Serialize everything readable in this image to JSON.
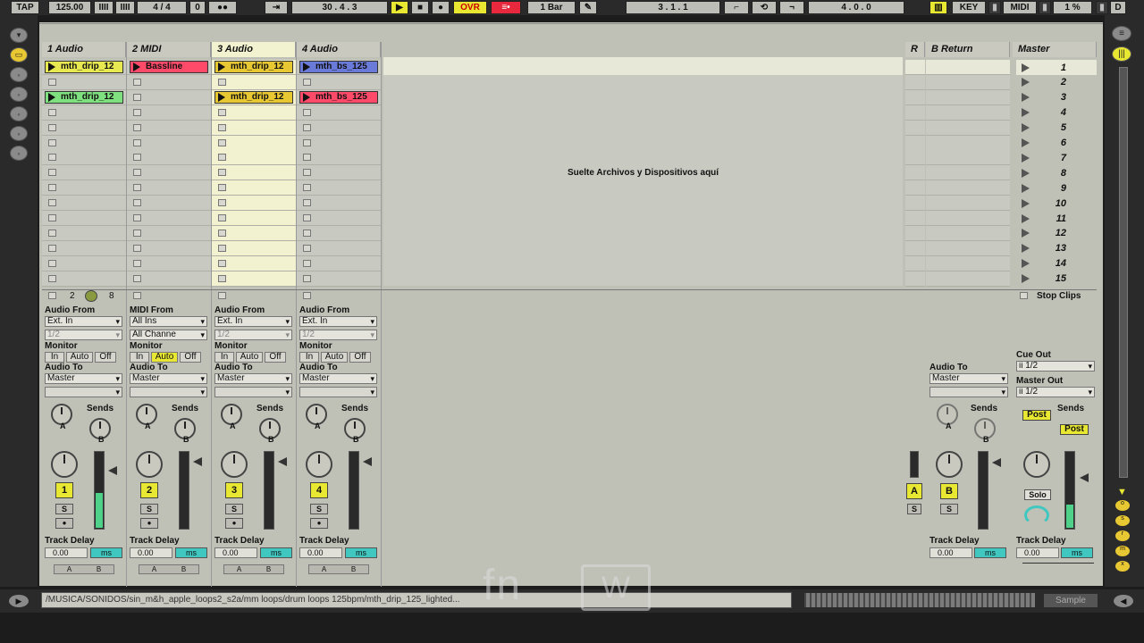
{
  "transport": {
    "tap": "TAP",
    "tempo": "125.00",
    "metronome_icon": "IIII",
    "sync_icon": "IIII",
    "signature": "4 / 4",
    "quant": "0",
    "dots": "●●",
    "follow": "⇥",
    "position": "30 .   4 .   3",
    "ovr": "OVR",
    "bar_setting": "1 Bar",
    "loop_pos": "3 .   1 .   1",
    "loop_len": "4 .   0 .   0",
    "key": "KEY",
    "midi": "MIDI",
    "cpu": "1 %",
    "d": "D"
  },
  "tracks": [
    {
      "name": "1 Audio",
      "number": "1",
      "input_label": "Audio From",
      "input": "Ext. In",
      "channel": "1/2",
      "monitor": [
        "In",
        "Auto",
        "Off"
      ],
      "output_label": "Audio To",
      "output": "Master"
    },
    {
      "name": "2 MIDI",
      "number": "2",
      "input_label": "MIDI From",
      "input": "All Ins",
      "channel": "All Channe",
      "monitor": [
        "In",
        "Auto",
        "Off"
      ],
      "output_label": "Audio To",
      "output": "Master"
    },
    {
      "name": "3 Audio",
      "number": "3",
      "input_label": "Audio From",
      "input": "Ext. In",
      "channel": "1/2",
      "monitor": [
        "In",
        "Auto",
        "Off"
      ],
      "output_label": "Audio To",
      "output": "Master"
    },
    {
      "name": "4 Audio",
      "number": "4",
      "input_label": "Audio From",
      "input": "Ext. In",
      "channel": "1/2",
      "monitor": [
        "In",
        "Auto",
        "Off"
      ],
      "output_label": "Audio To",
      "output": "Master"
    }
  ],
  "clips": {
    "t1_s1": "mth_drip_12",
    "t1_s3": "mth_drip_12",
    "t2_s1": "Bassline",
    "t3_s1": "mth_drip_12",
    "t3_s3": "mth_drip_12",
    "t4_s1": "mth_bs_125",
    "t4_s3": "mth_bs_125"
  },
  "drop_text": "Suelte Archivos y Dispositivos aquí",
  "returns": {
    "r_label": "R",
    "b_name": "B Return",
    "b_letter": "B",
    "a_letter": "A",
    "s_letter": "S",
    "output_label": "Audio To",
    "output": "Master"
  },
  "master": {
    "name": "Master",
    "scenes": [
      "1",
      "2",
      "3",
      "4",
      "5",
      "6",
      "7",
      "8",
      "9",
      "10",
      "11",
      "12",
      "13",
      "14",
      "15"
    ],
    "stop_clips": "Stop Clips",
    "cue_out_label": "Cue Out",
    "cue_out": "ii 1/2",
    "master_out_label": "Master Out",
    "master_out": "ii 1/2",
    "post": "Post",
    "solo": "Solo"
  },
  "mixer": {
    "sends": "Sends",
    "knob_a": "A",
    "knob_b": "B",
    "solo_letter": "S",
    "track_delay": "Track Delay",
    "delay_value": "0.00",
    "delay_unit": "ms"
  },
  "clip_stats": {
    "left": "2",
    "right": "8"
  },
  "browser_path": "/MUSICA/SONIDOS/sin_m&h_apple_loops2_s2a/mm loops/drum loops 125bpm/mth_drip_125_lighted...",
  "bottom_right": "Sample",
  "watermark": "fn",
  "meter_levels": {
    "t1": 0.45,
    "t2": 0,
    "t3": 0,
    "t4": 0,
    "master": 0.3
  }
}
